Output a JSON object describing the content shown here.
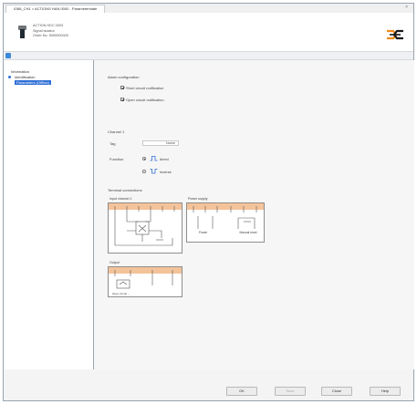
{
  "window": {
    "tab_title": "iO88_CH1 > ACTIONS HAN 0000 - Parameterstate",
    "close_label": "×"
  },
  "header": {
    "line1": "ACTION HDC 0003",
    "line2": "Signal isolator",
    "line3": "Order No. 5000000000"
  },
  "tree": {
    "items": [
      {
        "label": "Information"
      },
      {
        "label": "Identification"
      },
      {
        "label": "Parameters (Offline)"
      }
    ]
  },
  "main": {
    "alarm_title": "Alarm configuration",
    "alarm_short": "Short circuit notification",
    "alarm_open": "Open circuit notification",
    "channel_title": "Channel 1",
    "tag_label": "Tag",
    "tag_value": "Name",
    "function_label": "Function",
    "opt_direct": "direct",
    "opt_inverse": "inverse",
    "terminal_title": "Terminal connections",
    "input_title": "Input channel 1",
    "power_title": "Power supply",
    "power_label1": "Power",
    "power_label2": "Manual reset",
    "output_title": "Output",
    "output_caption": "Open circuit ..."
  },
  "footer": {
    "ok": "OK",
    "save": "Save",
    "close": "Close",
    "help": "Help"
  },
  "colors": {
    "accent": "#2f6fd6",
    "panel_header": "#f4c39a"
  }
}
